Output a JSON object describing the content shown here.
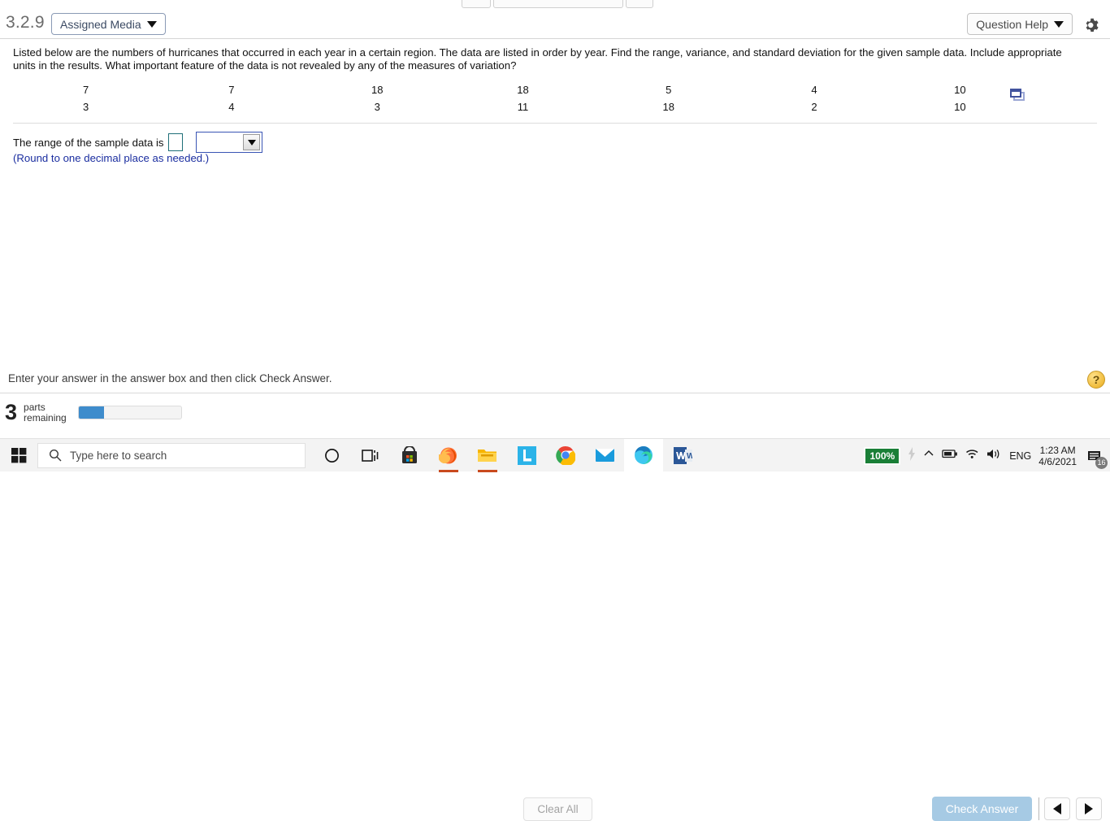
{
  "header": {
    "question_number": "3.2.9",
    "assigned_media_label": "Assigned Media",
    "question_help_label": "Question Help",
    "gear_icon": "gear-icon"
  },
  "problem": {
    "statement": "Listed below are the numbers of hurricanes that occurred in each year in a certain region. The data are listed in order by year. Find the range, variance, and standard deviation for the given sample data. Include appropriate units in the results. What important feature of the data is not revealed by any of the measures of variation?"
  },
  "data_table": {
    "row1": [
      "7",
      "7",
      "18",
      "18",
      "5",
      "4",
      "10"
    ],
    "row2": [
      "3",
      "4",
      "3",
      "11",
      "18",
      "2",
      "10"
    ],
    "popup_icon": "popup-window-icon"
  },
  "answer": {
    "label": "The range of the sample data is",
    "input_value": "",
    "input_placeholder": "",
    "select_value": "",
    "round_note": "(Round to one decimal place as needed.)"
  },
  "footer": {
    "instruction": "Enter your answer in the answer box and then click Check Answer.",
    "help_bubble": "?",
    "parts_count": "3",
    "parts_line1": "parts",
    "parts_line2": "remaining",
    "progress_percent": 25,
    "clear_all_label": "Clear All",
    "check_answer_label": "Check Answer",
    "prev_icon": "previous-arrow-icon",
    "next_icon": "next-arrow-icon"
  },
  "taskbar": {
    "start_icon": "windows-start-icon",
    "search_placeholder": "Type here to search",
    "search_icon": "search-icon",
    "icons": [
      {
        "name": "cortana-icon"
      },
      {
        "name": "task-view-icon"
      },
      {
        "name": "microsoft-store-icon"
      },
      {
        "name": "firefox-icon"
      },
      {
        "name": "file-explorer-icon"
      },
      {
        "name": "lockdown-browser-icon"
      },
      {
        "name": "google-chrome-icon"
      },
      {
        "name": "mail-icon"
      },
      {
        "name": "microsoft-edge-icon"
      },
      {
        "name": "microsoft-word-icon"
      }
    ],
    "tray": {
      "battery_percent": "100%",
      "charging_icon": "charging-bolt-icon",
      "chevron_icon": "show-hidden-icons-icon",
      "battery_icon": "battery-icon",
      "wifi_icon": "wifi-icon",
      "volume_icon": "volume-icon",
      "language": "ENG",
      "time": "1:23 AM",
      "date": "4/6/2021",
      "notification_icon": "notifications-icon",
      "notification_count": "16"
    }
  },
  "colors": {
    "accent_blue": "#3e8ccc",
    "check_answer_bg": "#a6cae4",
    "note_blue": "#1b2ea0",
    "battery_green": "#1a7f37"
  }
}
